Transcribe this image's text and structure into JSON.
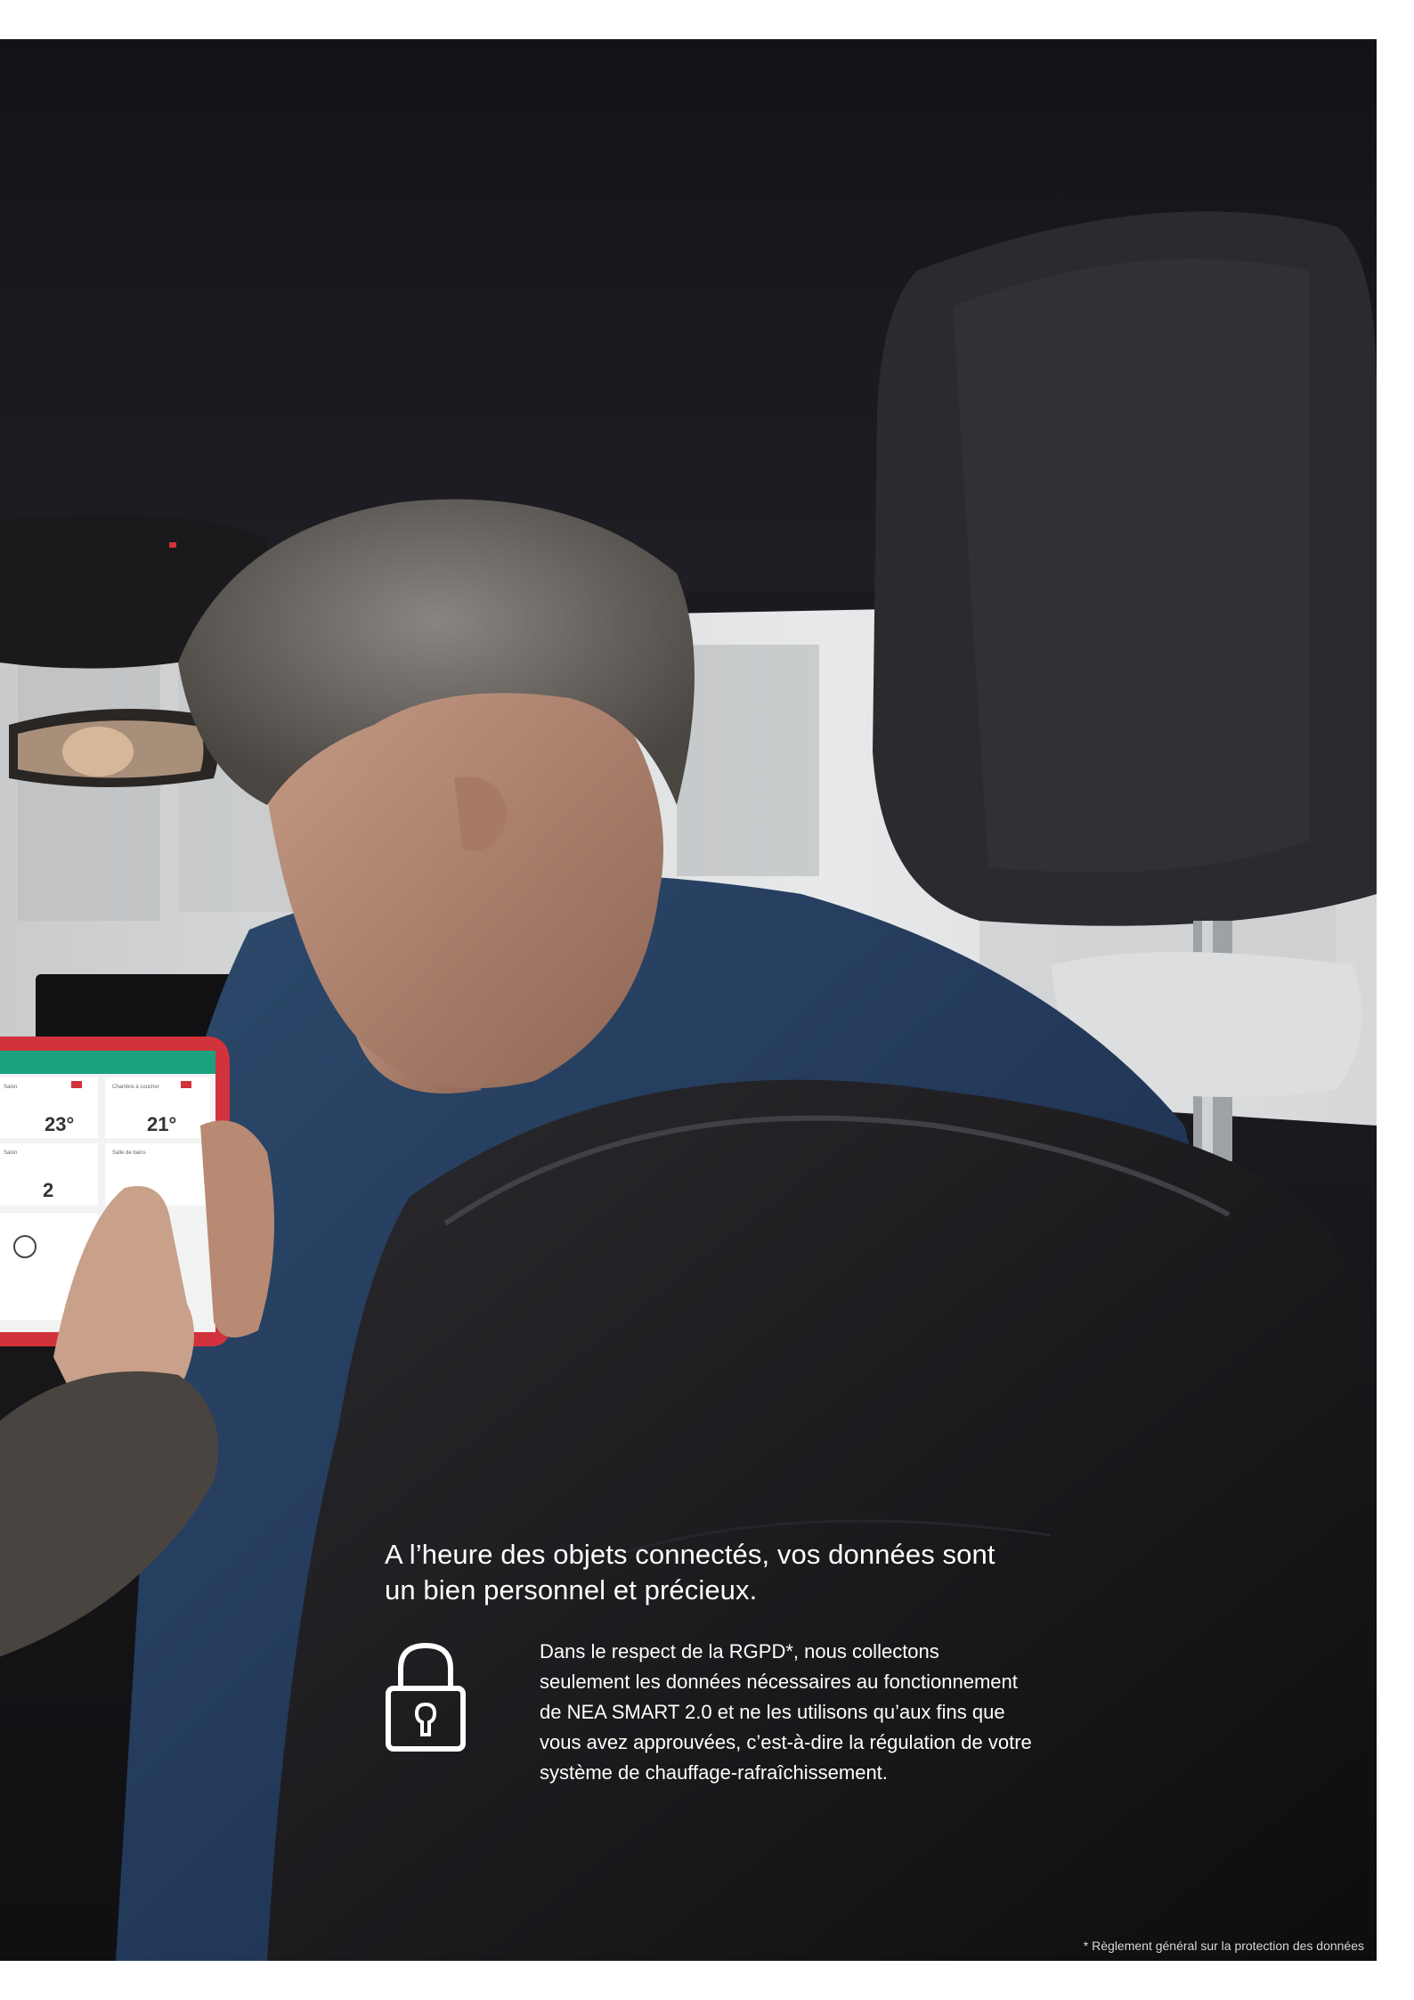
{
  "headline": {
    "line1": "A l’heure des objets connectés, vos données sont",
    "line2": "un bien personnel et précieux."
  },
  "body": {
    "lines": [
      "Dans le respect de la RGPD*, nous collectons",
      "seulement les données nécessaires au fonctionnement",
      "de NEA SMART 2.0 et ne les utilisons qu’aux fins que",
      "vous avez approuvées, c’est-à-dire la régulation de votre",
      "système de chauffage-rafraîchissement."
    ]
  },
  "footnote": "* Règlement général sur la protection des données",
  "tablet_screen": {
    "tiles": [
      {
        "temp": "23°",
        "label": "Salon"
      },
      {
        "temp": "21°",
        "label": "Chambre à coucher"
      },
      {
        "temp": "2",
        "label": "Salon"
      },
      {
        "temp": "",
        "label": "Salle de bains"
      }
    ]
  },
  "icons": [
    "lock-icon"
  ],
  "colors": {
    "text": "#ffffff",
    "background": "#141418",
    "tablet_case": "#d2323c",
    "app_accent": "#19a27e"
  }
}
